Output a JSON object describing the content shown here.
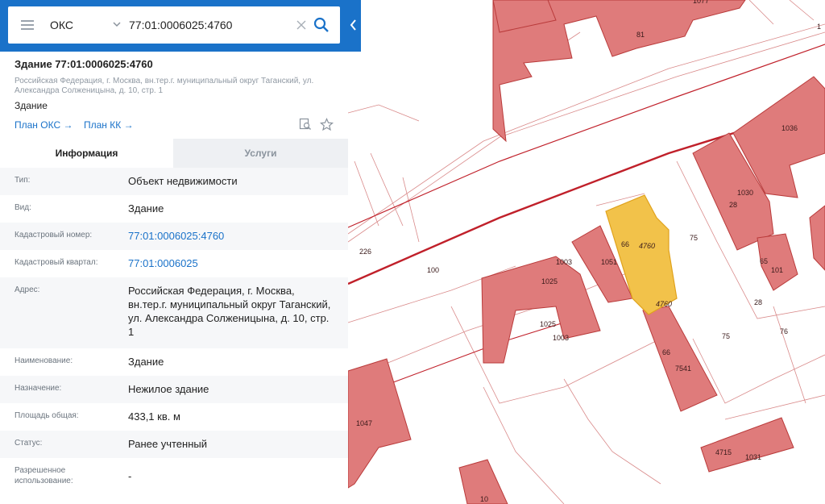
{
  "search": {
    "type_label": "ОКС",
    "query": "77:01:0006025:4760"
  },
  "object": {
    "title": "Здание 77:01:0006025:4760",
    "address": "Российская Федерация, г. Москва, вн.тер.г. муниципальный округ Таганский, ул. Александра Солженицына, д. 10, стр. 1",
    "kind": "Здание",
    "links": [
      "План ОКС →",
      "План КК →"
    ]
  },
  "tabs": [
    "Информация",
    "Услуги"
  ],
  "fields": [
    {
      "label": "Тип:",
      "value": "Объект недвижимости"
    },
    {
      "label": "Вид:",
      "value": "Здание"
    },
    {
      "label": "Кадастровый номер:",
      "value": "77:01:0006025:4760"
    },
    {
      "label": "Кадастровый квартал:",
      "value": "77:01:0006025"
    },
    {
      "label": "Адрес:",
      "value": "Российская Федерация, г. Москва, вн.тер.г. муниципальный округ Таганский, ул. Александра Солженицына, д. 10, стр. 1"
    },
    {
      "label": "Наименование:",
      "value": "Здание"
    },
    {
      "label": "Назначение:",
      "value": "Нежилое здание"
    },
    {
      "label": "Площадь общая:",
      "value": "433,1 кв. м"
    },
    {
      "label": "Статус:",
      "value": "Ранее учтенный"
    },
    {
      "label": "Разрешенное использование:",
      "value": "-"
    }
  ],
  "map": {
    "labels": [
      "81",
      "1036",
      "1030",
      "28",
      "1003",
      "1025",
      "1025",
      "1003",
      "1051",
      "66",
      "4760",
      "4760",
      "75",
      "226",
      "100",
      "65",
      "101",
      "28",
      "75",
      "76",
      "66",
      "7541",
      "1047",
      "4715",
      "1031",
      "10",
      "1077",
      "1"
    ],
    "colors": {
      "parcel_fill": "#df7b7b",
      "parcel_stroke": "#b93a3a",
      "road": "#c0202a",
      "selected_fill": "#f2c24a",
      "selected_stroke": "#e0a21c"
    }
  },
  "colors": {
    "header": "#1a72c9",
    "link": "#1a72c9"
  }
}
